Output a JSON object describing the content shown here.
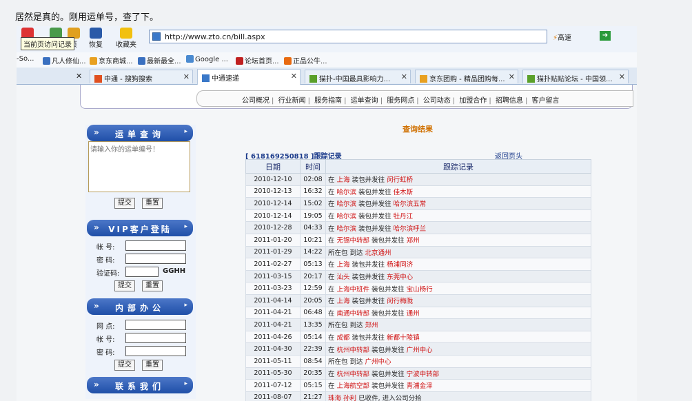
{
  "post": {
    "text": "居然是真的。刚用运单号，查了下。"
  },
  "browser": {
    "tooltip": "当前页访问记录",
    "toolbar": {
      "restore_label": "恢复",
      "favorites_label": "收藏夹",
      "page_label": "页"
    },
    "url": "http://www.zto.cn/bill.aspx",
    "speed_label": "高速",
    "bookmarks": [
      "-So...",
      "凡人修仙...",
      "京东商城...",
      "最新最全...",
      "Google ...",
      "论坛首页...",
      "正品公牛..."
    ],
    "tabs": [
      {
        "label": "中通 - 搜狗搜索"
      },
      {
        "label": "中通速递"
      },
      {
        "label": "猫扑-中国最具影响力..."
      },
      {
        "label": "京东团购 - 精品团购每..."
      },
      {
        "label": "猫扑贴贴论坛 - 中国领..."
      }
    ]
  },
  "site": {
    "nav": [
      "公司概况",
      "行业新闻",
      "服务指南",
      "运单查询",
      "服务网点",
      "公司动态",
      "加盟合作",
      "招聘信息",
      "客户留言"
    ],
    "sidebar": {
      "waybill": {
        "title": "运单查询",
        "placeholder": "请输入你的运单编号！",
        "submit": "提交",
        "reset": "重置"
      },
      "vip": {
        "title": "VIP客户登陆",
        "account": "帐  号:",
        "password": "密  码:",
        "captcha_label": "验证码:",
        "captcha": "GGHH",
        "submit": "提交",
        "reset": "重置"
      },
      "office": {
        "title": "内部办公",
        "site": "网  点:",
        "account": "帐  号:",
        "password": "密  码:",
        "submit": "提交",
        "reset": "重置"
      },
      "contact": {
        "title": "联系我们"
      }
    },
    "result_title": "查询结果",
    "tracking_header": "[ 618169250818 ]跟踪记录",
    "back_top": "返回页头",
    "table": {
      "headers": [
        "日期",
        "时间",
        "跟踪记录"
      ],
      "rows": [
        {
          "date": "2010-12-10",
          "time": "02:08",
          "pre": "在 ",
          "place1": "上海",
          "mid": " 装包并发往 ",
          "place2": "闵行虹桥"
        },
        {
          "date": "2010-12-13",
          "time": "16:32",
          "pre": "在 ",
          "place1": "哈尔滨",
          "mid": " 装包并发往 ",
          "place2": "佳木斯"
        },
        {
          "date": "2010-12-14",
          "time": "15:02",
          "pre": "在 ",
          "place1": "哈尔滨",
          "mid": " 装包并发往 ",
          "place2": "哈尔滨五常"
        },
        {
          "date": "2010-12-14",
          "time": "19:05",
          "pre": "在 ",
          "place1": "哈尔滨",
          "mid": " 装包并发往 ",
          "place2": "牡丹江"
        },
        {
          "date": "2010-12-28",
          "time": "04:33",
          "pre": "在 ",
          "place1": "哈尔滨",
          "mid": " 装包并发往 ",
          "place2": "哈尔滨呼兰"
        },
        {
          "date": "2011-01-20",
          "time": "10:21",
          "pre": "在 ",
          "place1": "无锡中转部",
          "mid": " 装包并发往 ",
          "place2": "郑州"
        },
        {
          "date": "2011-01-29",
          "time": "14:22",
          "pre": "所在包 到达 ",
          "place1": "北京通州",
          "mid": "",
          "place2": ""
        },
        {
          "date": "2011-02-27",
          "time": "05:13",
          "pre": "在 ",
          "place1": "上海",
          "mid": " 装包并发往 ",
          "place2": "杨浦同济"
        },
        {
          "date": "2011-03-15",
          "time": "20:17",
          "pre": "在 ",
          "place1": "汕头",
          "mid": " 装包并发往 ",
          "place2": "东莞中心"
        },
        {
          "date": "2011-03-23",
          "time": "12:59",
          "pre": "在 ",
          "place1": "上海中班件",
          "mid": " 装包并发往 ",
          "place2": "宝山杨行"
        },
        {
          "date": "2011-04-14",
          "time": "20:05",
          "pre": "在 ",
          "place1": "上海",
          "mid": " 装包并发往 ",
          "place2": "闵行梅陇"
        },
        {
          "date": "2011-04-21",
          "time": "06:48",
          "pre": "在 ",
          "place1": "南通中转部",
          "mid": " 装包并发往 ",
          "place2": "通州"
        },
        {
          "date": "2011-04-21",
          "time": "13:35",
          "pre": "所在包 到达 ",
          "place1": "郑州",
          "mid": "",
          "place2": ""
        },
        {
          "date": "2011-04-26",
          "time": "05:14",
          "pre": "在 ",
          "place1": "成都",
          "mid": " 装包并发往 ",
          "place2": "新都十陵镇"
        },
        {
          "date": "2011-04-30",
          "time": "22:39",
          "pre": "在 ",
          "place1": "杭州中转部",
          "mid": " 装包并发往 ",
          "place2": "广州中心"
        },
        {
          "date": "2011-05-11",
          "time": "08:54",
          "pre": "所在包 到达 ",
          "place1": "广州中心",
          "mid": "",
          "place2": ""
        },
        {
          "date": "2011-05-30",
          "time": "20:35",
          "pre": "在 ",
          "place1": "杭州中转部",
          "mid": " 装包并发往 ",
          "place2": "宁波中转部"
        },
        {
          "date": "2011-07-12",
          "time": "05:15",
          "pre": "在 ",
          "place1": "上海航空部",
          "mid": " 装包并发往 ",
          "place2": "青浦金泽"
        },
        {
          "date": "2011-08-07",
          "time": "21:27",
          "pre": "",
          "place1": "珠海",
          "mid": " ",
          "place2": "孙利",
          "post": " 已收件, 进入公司分拾"
        }
      ]
    }
  }
}
